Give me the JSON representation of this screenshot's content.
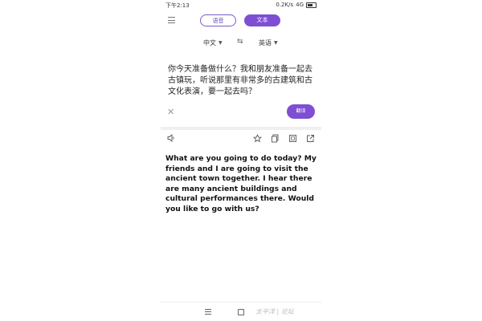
{
  "status": {
    "time": "下午2:13",
    "network": "0.2K/s",
    "signal": "4G"
  },
  "modes": {
    "voice_label": "语音",
    "text_label": "文本"
  },
  "languages": {
    "source": "中文",
    "target": "英语",
    "swap_icon": "swap-arrows-icon"
  },
  "input": {
    "text": "你今天准备做什么？我和朋友准备一起去古镇玩，听说那里有非常多的古建筑和古文化表演，要一起去吗？"
  },
  "translate_button": "翻译",
  "result": {
    "text": "What are you going to do today? My friends and I are going to visit the ancient town together. I hear there are many ancient buildings and cultural performances there. Would you like to go with us?"
  },
  "watermark": "太平洋 | 论坛",
  "colors": {
    "accent": "#7e4fd3"
  }
}
